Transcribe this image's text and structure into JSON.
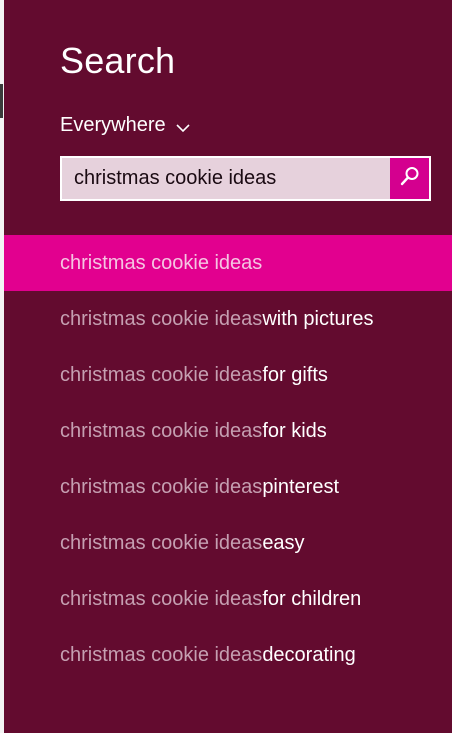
{
  "colors": {
    "panel_bg": "#630b2f",
    "accent": "#e2008f",
    "search_button": "#d4008f",
    "search_field_bg": "#e6d1dc"
  },
  "search": {
    "title": "Search",
    "scope_label": "Everywhere",
    "scope_icon": "chevron-down-icon",
    "query": "christmas cookie ideas",
    "button_icon": "magnifier-icon"
  },
  "suggestions": [
    {
      "query": "christmas cookie ideas",
      "completion": ""
    },
    {
      "query": "christmas cookie ideas",
      "completion": " with pictures"
    },
    {
      "query": "christmas cookie ideas",
      "completion": " for gifts"
    },
    {
      "query": "christmas cookie ideas",
      "completion": " for kids"
    },
    {
      "query": "christmas cookie ideas",
      "completion": " pinterest"
    },
    {
      "query": "christmas cookie ideas",
      "completion": " easy"
    },
    {
      "query": "christmas cookie ideas",
      "completion": " for children"
    },
    {
      "query": "christmas cookie ideas",
      "completion": " decorating"
    }
  ]
}
